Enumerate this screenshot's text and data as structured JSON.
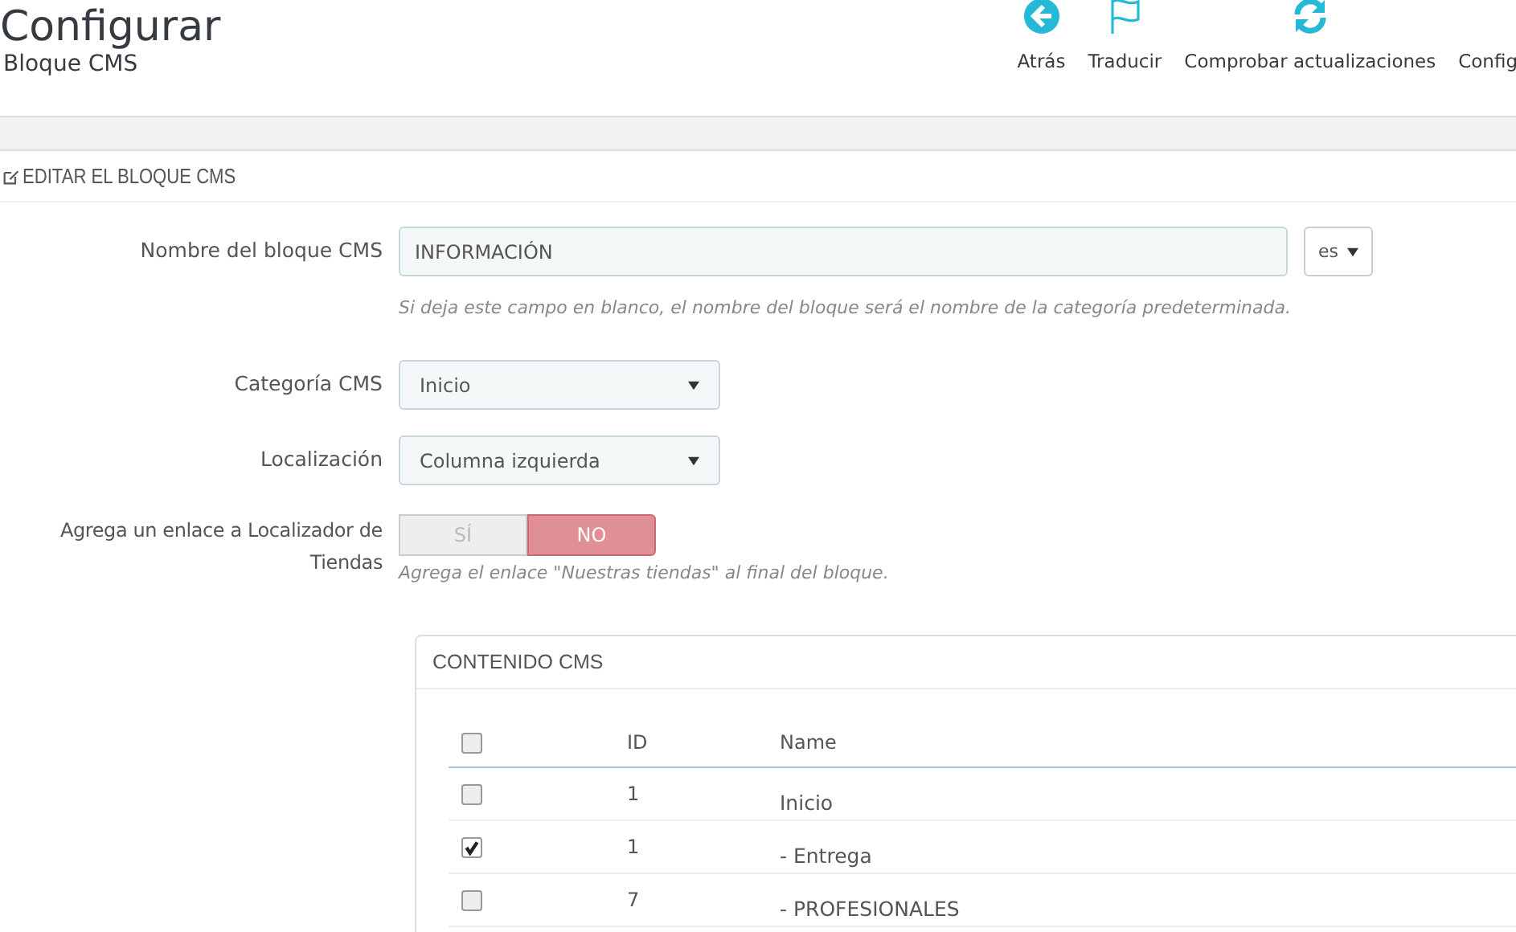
{
  "header": {
    "title": "Configurar",
    "subtitle": "Bloque CMS"
  },
  "toolbar": [
    {
      "label": "Atrás",
      "kind": "back"
    },
    {
      "label": "Traducir",
      "kind": "flag"
    },
    {
      "label": "Comprobar actualizaciones",
      "kind": "refresh"
    },
    {
      "label": "Config",
      "kind": "none"
    }
  ],
  "panel": {
    "title": "EDITAR EL BLOQUE CMS"
  },
  "form": {
    "name": {
      "label": "Nombre del bloque CMS",
      "value": "INFORMACIÓN",
      "language": "es",
      "help": "Si deja este campo en blanco, el nombre del bloque será el nombre de la categoría predeterminada."
    },
    "category": {
      "label": "Categoría CMS",
      "value": "Inicio"
    },
    "location": {
      "label": "Localización",
      "value": "Columna izquierda"
    },
    "store_link": {
      "label": "Agrega un enlace a Localizador de Tiendas",
      "options": [
        {
          "label": "SÍ",
          "selected": false
        },
        {
          "label": "NO",
          "selected": true
        }
      ],
      "help": "Agrega el enlace \"Nuestras tiendas\" al final del bloque."
    }
  },
  "content": {
    "title": "CONTENIDO CMS",
    "columns": [
      "ID",
      "Name"
    ],
    "header_checked": false,
    "rows": [
      {
        "checked": false,
        "id": "1",
        "name": "Inicio"
      },
      {
        "checked": true,
        "id": "1",
        "name": "- Entrega"
      },
      {
        "checked": false,
        "id": "7",
        "name": "- PROFESIONALES"
      }
    ]
  }
}
